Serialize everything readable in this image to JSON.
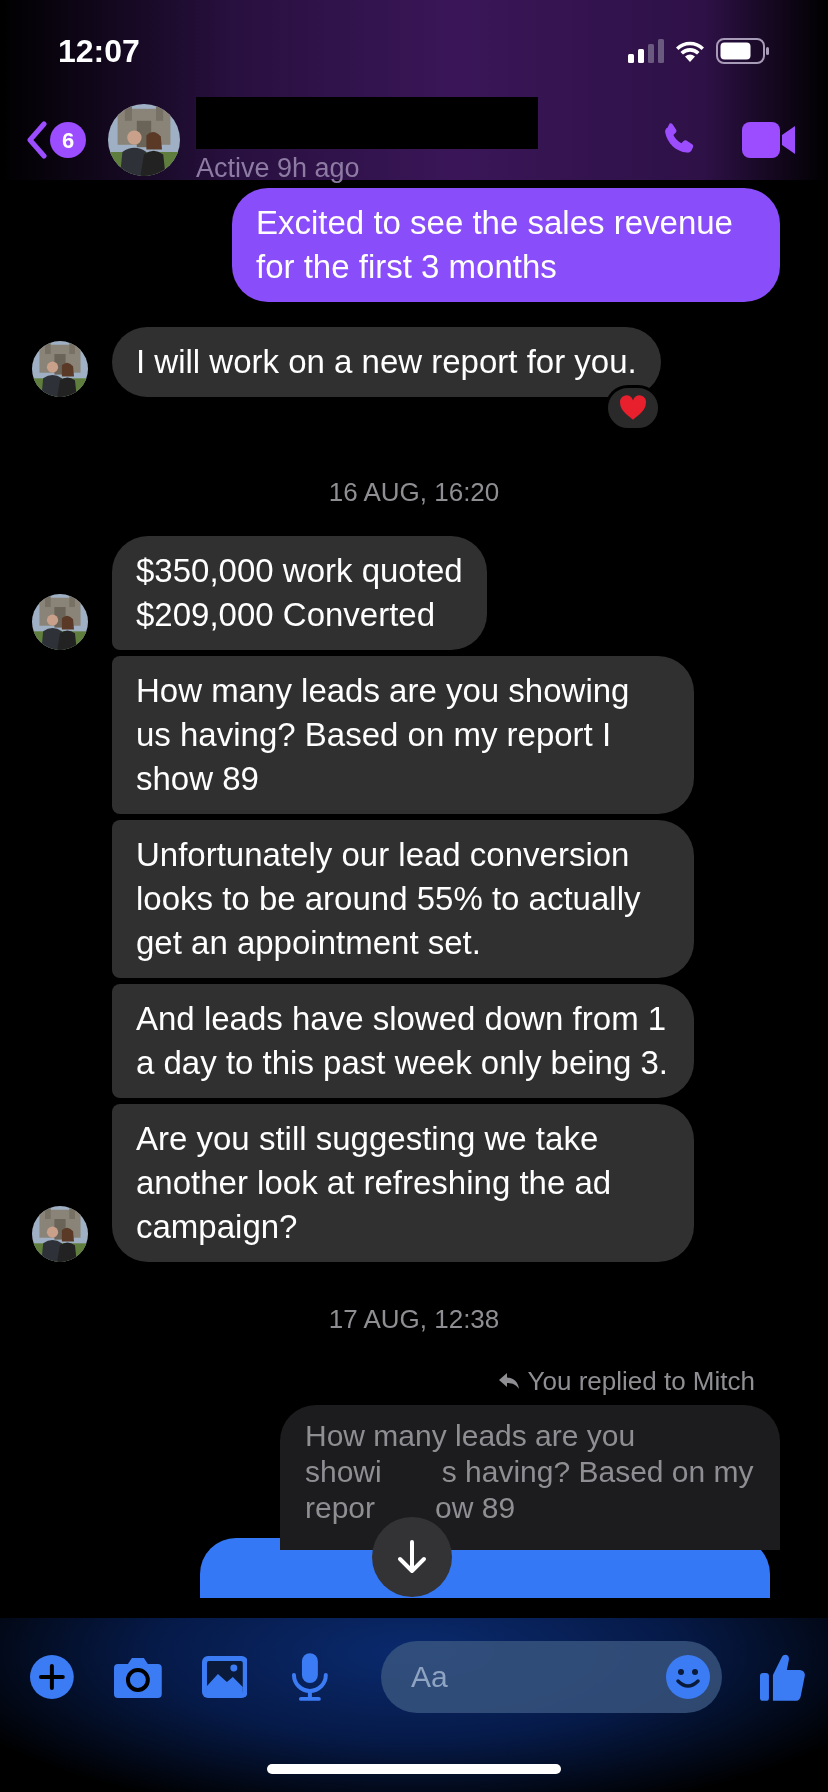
{
  "status_bar": {
    "time": "12:07"
  },
  "header": {
    "back_badge": "6",
    "status": "Active 9h ago"
  },
  "messages": [
    {
      "kind": "sent",
      "lines": "Excited to see the sales revenue for the first 3 months"
    },
    {
      "kind": "received",
      "text": "I will work on a new report for you.",
      "show_avatar": true,
      "reacted": true
    },
    {
      "kind": "date",
      "text": "16 AUG, 16:20"
    },
    {
      "kind": "received",
      "text": "$350,000 work quoted\n$209,000 Converted",
      "show_avatar": true,
      "reacted": false
    },
    {
      "kind": "received",
      "text": "How many leads are you showing us having? Based on my report I show 89",
      "show_avatar": false,
      "reacted": false
    },
    {
      "kind": "received",
      "text": "Unfortunately our lead conversion looks to be around 55% to actually get an appointment set.",
      "show_avatar": false,
      "reacted": false
    },
    {
      "kind": "received",
      "text": "And leads have slowed down from 1 a day to this past week only being 3.",
      "show_avatar": false,
      "reacted": false
    },
    {
      "kind": "received",
      "text": "Are you still suggesting we take another look at refreshing the ad campaign?",
      "show_avatar": true,
      "reacted": false
    },
    {
      "kind": "date",
      "text": "17 AUG, 12:38"
    },
    {
      "kind": "reply_label",
      "text": "You replied to Mitch"
    },
    {
      "kind": "quote",
      "lines": [
        {
          "left": "How many leads are you"
        },
        {
          "left": "showi",
          "right": "s having? Based on my"
        },
        {
          "left": "repor",
          "right": "ow 89"
        }
      ]
    },
    {
      "kind": "sent_partial"
    }
  ],
  "composer": {
    "placeholder": "Aa"
  }
}
